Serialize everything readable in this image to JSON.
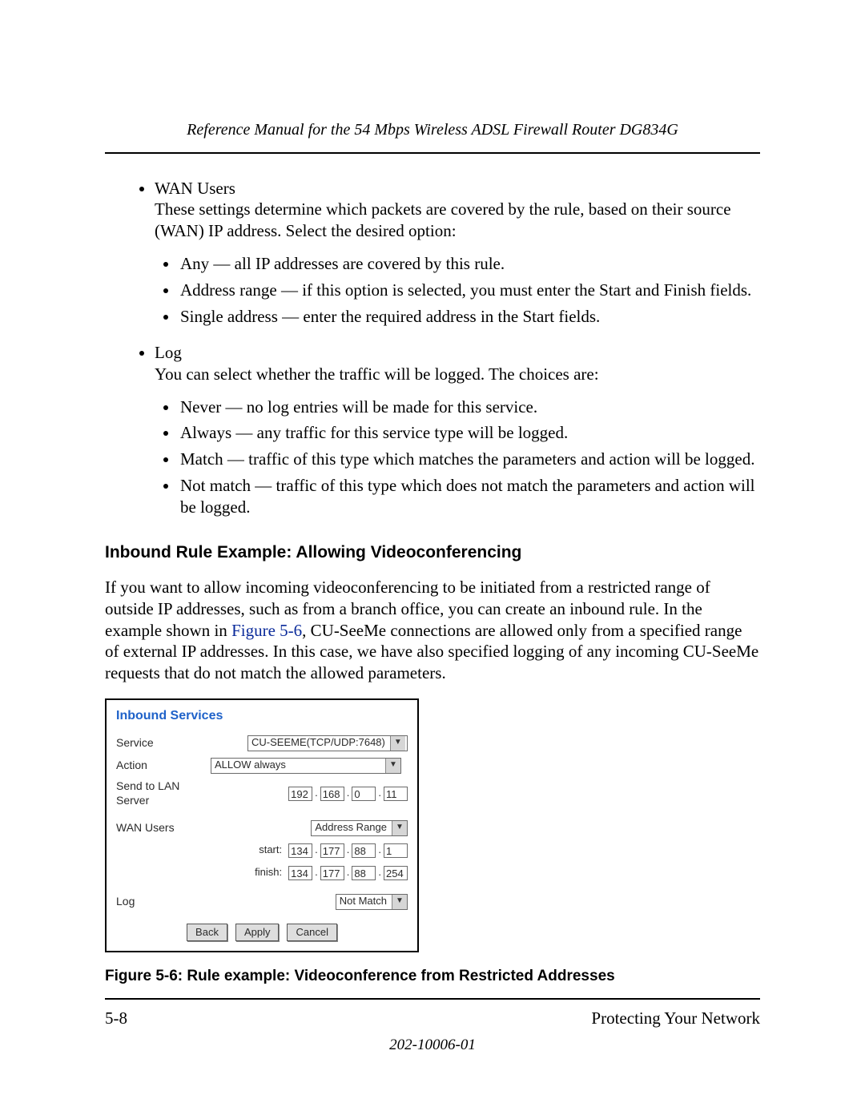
{
  "header": {
    "running": "Reference Manual for the 54 Mbps Wireless ADSL Firewall Router DG834G"
  },
  "bullets": {
    "wan_title": "WAN Users",
    "wan_desc": "These settings determine which packets are covered by the rule, based on their source (WAN) IP address. Select the desired option:",
    "wan_items": {
      "a": "Any — all IP addresses are covered by this rule.",
      "b": "Address range — if this option is selected, you must enter the Start and Finish fields.",
      "c": "Single address — enter the required address in the Start fields."
    },
    "log_title": "Log",
    "log_desc": "You can select whether the traffic will be logged. The choices are:",
    "log_items": {
      "a": "Never — no log entries will be made for this service.",
      "b": "Always — any traffic for this service type will be logged.",
      "c": "Match — traffic of this type which matches the parameters and action will be logged.",
      "d": "Not match — traffic of this type which does not match the parameters and action will be logged."
    }
  },
  "section_heading": "Inbound Rule Example: Allowing Videoconferencing",
  "para": {
    "pre": "If you want to allow incoming videoconferencing to be initiated from a restricted range of outside IP addresses, such as from a branch office, you can create an inbound rule. In the example shown in ",
    "link": "Figure 5-6",
    "post": ", CU-SeeMe connections are allowed only from a specified range of external IP addresses. In this case, we have also specified logging of any incoming CU-SeeMe requests that do not match the allowed parameters."
  },
  "panel": {
    "title": "Inbound Services",
    "labels": {
      "service": "Service",
      "action": "Action",
      "send_to": "Send to LAN Server",
      "wan_users": "WAN Users",
      "start": "start:",
      "finish": "finish:",
      "log": "Log"
    },
    "values": {
      "service": "CU-SEEME(TCP/UDP:7648)",
      "action": "ALLOW always",
      "wan_users": "Address Range",
      "log": "Not Match"
    },
    "ip_send": {
      "a": "192",
      "b": "168",
      "c": "0",
      "d": "11"
    },
    "ip_start": {
      "a": "134",
      "b": "177",
      "c": "88",
      "d": "1"
    },
    "ip_finish": {
      "a": "134",
      "b": "177",
      "c": "88",
      "d": "254"
    },
    "buttons": {
      "back": "Back",
      "apply": "Apply",
      "cancel": "Cancel"
    }
  },
  "fig_caption": "Figure 5-6:  Rule example: Videoconference from Restricted Addresses",
  "footer": {
    "page": "5-8",
    "section": "Protecting Your Network",
    "docnum": "202-10006-01"
  }
}
